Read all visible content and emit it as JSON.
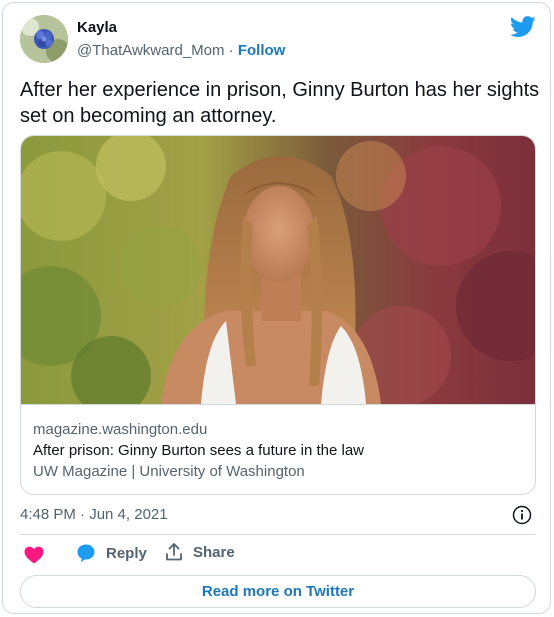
{
  "author": {
    "name": "Kayla",
    "handle": "@ThatAwkward_Mom",
    "separator": "·",
    "follow_label": "Follow"
  },
  "tweet": {
    "text": "After her experience in prison, Ginny Burton has her sights set on becoming an attorney."
  },
  "link_card": {
    "domain": "magazine.washington.edu",
    "title": "After prison: Ginny Burton sees a future in the law",
    "source": "UW Magazine | University of Washington"
  },
  "timestamp": "4:48 PM · Jun 4, 2021",
  "actions": {
    "reply_label": "Reply",
    "share_label": "Share"
  },
  "read_more_label": "Read more on Twitter",
  "colors": {
    "accent": "#1d77b8",
    "twitter_blue": "#1d9bf0",
    "heart": "#f91880",
    "muted_text": "#536471",
    "border": "#cfd9de"
  },
  "icons": [
    "twitter-bird-icon",
    "info-icon",
    "heart-icon",
    "reply-bubble-icon",
    "share-icon"
  ]
}
